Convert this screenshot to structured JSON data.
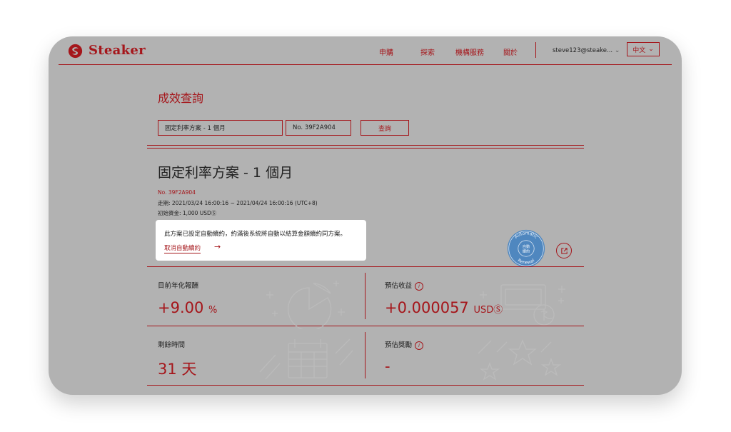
{
  "header": {
    "brand": "Steaker",
    "nav": [
      "申購",
      "探索",
      "機構服務",
      "關於"
    ],
    "user_email": "steve123@steake...",
    "language": "中文"
  },
  "search": {
    "title": "成效查詢",
    "plan_value": "固定利率方案 - 1 個月",
    "no_value": "No. 39F2A904",
    "query_label": "查詢"
  },
  "plan": {
    "title": "固定利率方案 - 1 個月",
    "number": "No. 39F2A904",
    "period": "走期: 2021/03/24 16:00:16 ~ 2021/04/24 16:00:16 (UTC+8)",
    "initial_capital": "初始資金: 1,000 USDⓈ"
  },
  "notice": {
    "text": "此方案已設定自動續約，約滿後系統將自動以結算金額續約同方案。",
    "cancel_link": "取消自動續約",
    "arrow": "→"
  },
  "stamp": {
    "top_text": "Automatic",
    "bottom_text": "Renewal",
    "center_line1": "自動",
    "center_line2": "續約"
  },
  "stats": {
    "annual_label": "目前年化報酬",
    "annual_value": "+9.00",
    "annual_unit": "%",
    "income_label": "預估收益",
    "income_value": "+0.000057",
    "income_unit": "USDⓈ",
    "remaining_label": "剩餘時間",
    "remaining_value": "31",
    "remaining_unit": "天",
    "reward_label": "預估獎勵",
    "reward_value": "-",
    "info_glyph": "i"
  },
  "colors": {
    "accent": "#a5161b",
    "overlay": "#b2b2b2",
    "highlight": "#ffffff",
    "stamp": "#3d7fc1"
  }
}
